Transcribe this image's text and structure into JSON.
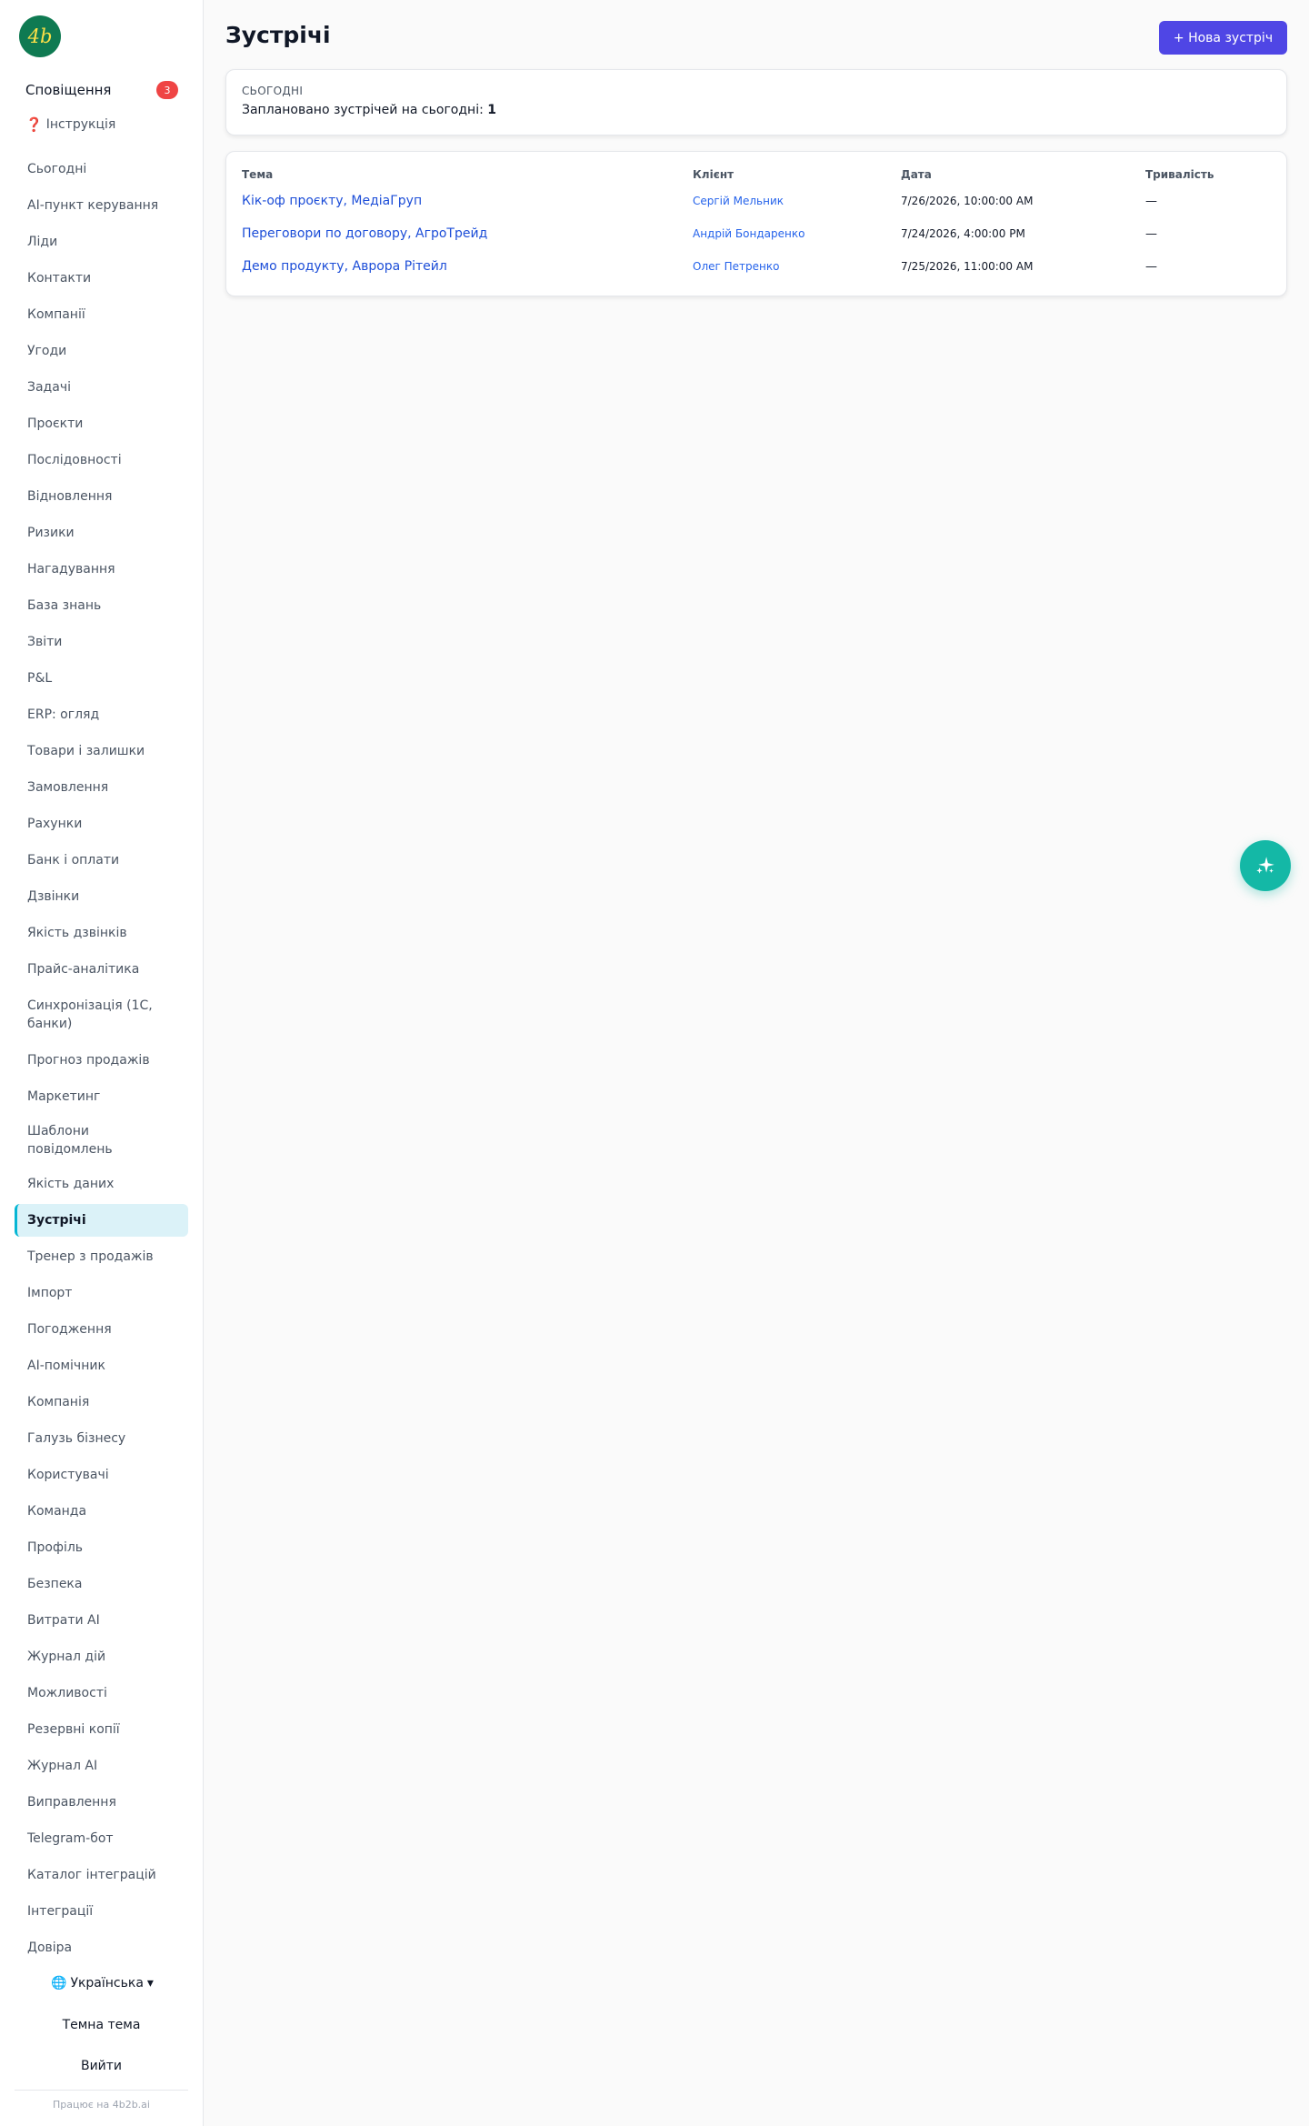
{
  "brand": {
    "logo_text": "4b"
  },
  "sidebar": {
    "notifications": {
      "label": "Сповіщення",
      "count": "3"
    },
    "guide": {
      "icon": "❓",
      "label": "Інструкція"
    },
    "items": [
      "Сьогодні",
      "AI-пункт керування",
      "Ліди",
      "Контакти",
      "Компанії",
      "Угоди",
      "Задачі",
      "Проєкти",
      "Послідовності",
      "Відновлення",
      "Ризики",
      "Нагадування",
      "База знань",
      "Звіти",
      "P&L",
      "ERP: огляд",
      "Товари і залишки",
      "Замовлення",
      "Рахунки",
      "Банк і оплати",
      "Дзвінки",
      "Якість дзвінків",
      "Прайс-аналітика",
      "Синхронізація (1С, банки)",
      "Прогноз продажів",
      "Маркетинг",
      "Шаблони повідомлень",
      "Якість даних",
      "Зустрічі",
      "Тренер з продажів",
      "Імпорт",
      "Погодження",
      "AI-помічник",
      "Компанія",
      "Галузь бізнесу",
      "Користувачі",
      "Команда",
      "Профіль",
      "Безпека",
      "Витрати AI",
      "Журнал дій",
      "Можливості",
      "Резервні копії",
      "Журнал AI",
      "Виправлення",
      "Telegram-бот",
      "Каталог інтеграцій",
      "Інтеграції",
      "Довіра"
    ],
    "active_item": "Зустрічі",
    "language": {
      "icon": "🌐",
      "label": "Українська",
      "caret": "▾"
    },
    "theme_label": "Темна тема",
    "logout_label": "Вийти",
    "powered_by": "Працює на 4b2b.ai"
  },
  "header": {
    "title": "Зустрічі",
    "new_button": "+ Нова зустріч"
  },
  "today": {
    "label": "СЬОГОДНІ",
    "text": "Заплановано зустрічей на сьогодні:",
    "count": "1"
  },
  "table": {
    "columns": [
      "Тема",
      "Клієнт",
      "Дата",
      "Тривалість"
    ],
    "rows": [
      {
        "topic": "Кік-оф проєкту, МедіаГруп",
        "client": "Сергій Мельник",
        "date": "7/26/2026, 10:00:00 AM",
        "duration": "—"
      },
      {
        "topic": "Переговори по договору, АгроТрейд",
        "client": "Андрій Бондаренко",
        "date": "7/24/2026, 4:00:00 PM",
        "duration": "—"
      },
      {
        "topic": "Демо продукту, Аврора Рітейл",
        "client": "Олег Петренко",
        "date": "7/25/2026, 11:00:00 AM",
        "duration": "—"
      }
    ]
  },
  "fab": {
    "icon": "sparkles-icon"
  },
  "colors": {
    "primary": "#4f46e5",
    "teal": "#14b8a6",
    "active_bg": "#dbf2f8",
    "badge": "#ef4444"
  }
}
